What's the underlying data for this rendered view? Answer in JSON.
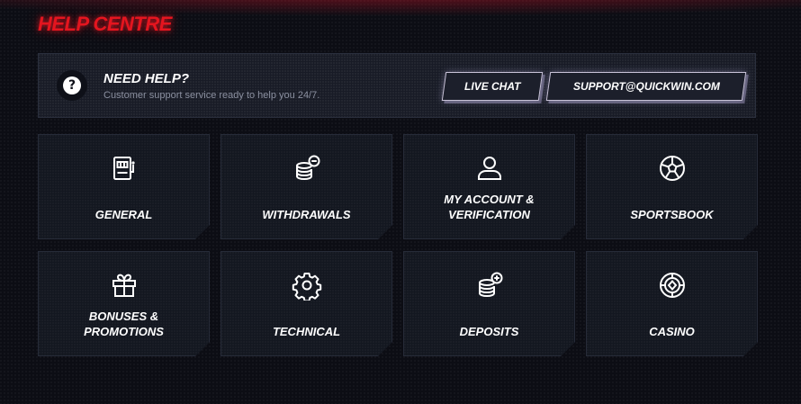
{
  "page": {
    "title": "HELP CENTRE"
  },
  "help": {
    "title": "NEED HELP?",
    "subtitle": "Customer support service ready to help you 24/7.",
    "icon": "question-icon",
    "live_chat_label": "LIVE CHAT",
    "email_label": "SUPPORT@QUICKWIN.COM"
  },
  "categories": [
    {
      "label": "GENERAL",
      "icon": "slot-machine-icon"
    },
    {
      "label": "WITHDRAWALS",
      "icon": "coins-minus-icon"
    },
    {
      "label": "MY ACCOUNT &\nVERIFICATION",
      "icon": "user-icon"
    },
    {
      "label": "SPORTSBOOK",
      "icon": "soccer-ball-icon"
    },
    {
      "label": "BONUSES &\nPROMOTIONS",
      "icon": "gift-icon"
    },
    {
      "label": "TECHNICAL",
      "icon": "gear-icon"
    },
    {
      "label": "DEPOSITS",
      "icon": "coins-plus-icon"
    },
    {
      "label": "CASINO",
      "icon": "casino-chip-icon"
    }
  ],
  "colors": {
    "accent": "#e4151f",
    "panel": "#181b26",
    "card": "#131720",
    "text_muted": "#8b90a0"
  }
}
